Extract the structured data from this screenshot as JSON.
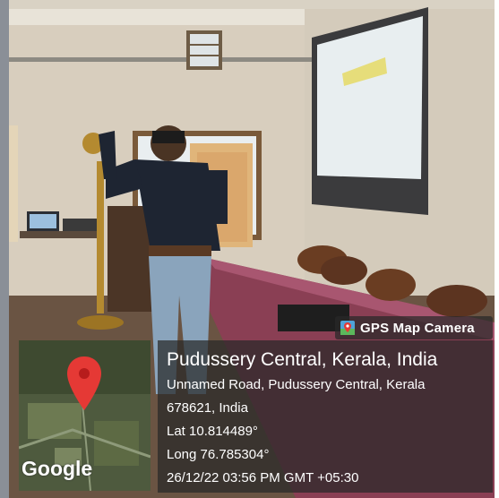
{
  "camera_badge": {
    "label": "GPS Map Camera",
    "icon": "map-pin-icon"
  },
  "location": {
    "title": "Pudussery Central, Kerala, India",
    "address_line1": "Unnamed Road, Pudussery Central, Kerala",
    "address_line2": "678621, India",
    "lat": "Lat 10.814489°",
    "long": "Long 76.785304°",
    "timestamp": "26/12/22 03:56 PM GMT +05:30"
  },
  "map": {
    "logo_text": "Google",
    "marker_color": "#e53935"
  },
  "colors": {
    "overlay": "#282828",
    "text": "#ffffff"
  }
}
